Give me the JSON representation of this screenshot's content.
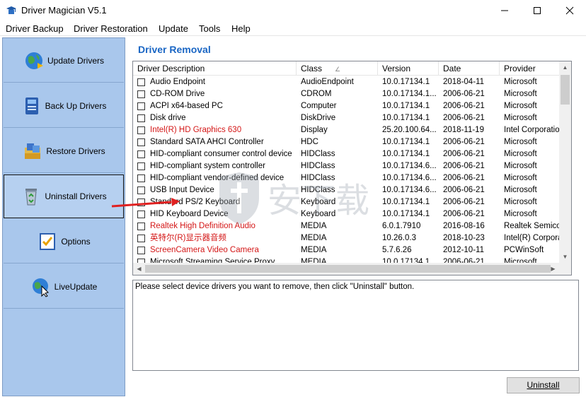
{
  "window": {
    "title": "Driver Magician V5.1",
    "icon": "graduation-cap-icon",
    "controls": [
      "minimize-icon",
      "maximize-icon",
      "close-icon"
    ]
  },
  "menu": [
    "Driver Backup",
    "Driver Restoration",
    "Update",
    "Tools",
    "Help"
  ],
  "sidebar": {
    "items": [
      {
        "label": "Update Drivers",
        "icon": "globe-update-icon"
      },
      {
        "label": "Back Up Drivers",
        "icon": "backup-icon"
      },
      {
        "label": "Restore Drivers",
        "icon": "restore-icon"
      },
      {
        "label": "Uninstall Drivers",
        "icon": "recycle-bin-icon",
        "active": true
      },
      {
        "label": "Options",
        "icon": "checklist-icon"
      },
      {
        "label": "LiveUpdate",
        "icon": "globe-cursor-icon"
      }
    ]
  },
  "main": {
    "title": "Driver Removal",
    "columns": [
      "Driver Description",
      "Class",
      "Version",
      "Date",
      "Provider"
    ],
    "rows": [
      {
        "desc": "Audio Endpoint",
        "class": "AudioEndpoint",
        "version": "10.0.17134.1",
        "date": "2018-04-11",
        "provider": "Microsoft",
        "red": false
      },
      {
        "desc": "CD-ROM Drive",
        "class": "CDROM",
        "version": "10.0.17134.1...",
        "date": "2006-06-21",
        "provider": "Microsoft",
        "red": false
      },
      {
        "desc": "ACPI x64-based PC",
        "class": "Computer",
        "version": "10.0.17134.1",
        "date": "2006-06-21",
        "provider": "Microsoft",
        "red": false
      },
      {
        "desc": "Disk drive",
        "class": "DiskDrive",
        "version": "10.0.17134.1",
        "date": "2006-06-21",
        "provider": "Microsoft",
        "red": false
      },
      {
        "desc": "Intel(R) HD Graphics 630",
        "class": "Display",
        "version": "25.20.100.64...",
        "date": "2018-11-19",
        "provider": "Intel Corporation",
        "red": true
      },
      {
        "desc": "Standard SATA AHCI Controller",
        "class": "HDC",
        "version": "10.0.17134.1",
        "date": "2006-06-21",
        "provider": "Microsoft",
        "red": false
      },
      {
        "desc": "HID-compliant consumer control device",
        "class": "HIDClass",
        "version": "10.0.17134.1",
        "date": "2006-06-21",
        "provider": "Microsoft",
        "red": false
      },
      {
        "desc": "HID-compliant system controller",
        "class": "HIDClass",
        "version": "10.0.17134.6...",
        "date": "2006-06-21",
        "provider": "Microsoft",
        "red": false
      },
      {
        "desc": "HID-compliant vendor-defined device",
        "class": "HIDClass",
        "version": "10.0.17134.6...",
        "date": "2006-06-21",
        "provider": "Microsoft",
        "red": false
      },
      {
        "desc": "USB Input Device",
        "class": "HIDClass",
        "version": "10.0.17134.6...",
        "date": "2006-06-21",
        "provider": "Microsoft",
        "red": false
      },
      {
        "desc": "Standard PS/2 Keyboard",
        "class": "Keyboard",
        "version": "10.0.17134.1",
        "date": "2006-06-21",
        "provider": "Microsoft",
        "red": false
      },
      {
        "desc": "HID Keyboard Device",
        "class": "Keyboard",
        "version": "10.0.17134.1",
        "date": "2006-06-21",
        "provider": "Microsoft",
        "red": false
      },
      {
        "desc": "Realtek High Definition Audio",
        "class": "MEDIA",
        "version": "6.0.1.7910",
        "date": "2016-08-16",
        "provider": "Realtek Semiconductor",
        "red": true
      },
      {
        "desc": "英特尔(R)显示器音频",
        "class": "MEDIA",
        "version": "10.26.0.3",
        "date": "2018-10-23",
        "provider": "Intel(R) Corporation",
        "red": true
      },
      {
        "desc": "ScreenCamera Video Camera",
        "class": "MEDIA",
        "version": "5.7.6.26",
        "date": "2012-10-11",
        "provider": "PCWinSoft",
        "red": true
      },
      {
        "desc": "Microsoft Streaming Service Proxy",
        "class": "MEDIA",
        "version": "10.0.17134.1",
        "date": "2006-06-21",
        "provider": "Microsoft",
        "red": false
      }
    ],
    "info_text": "Please select device drivers you want to remove, then click \"Uninstall\" button.",
    "uninstall_label": "Uninstall"
  },
  "watermark_text": "安下载",
  "colors": {
    "sidebar_bg": "#a9c7ec",
    "title_blue": "#1a66c4",
    "highlight_red": "#d41616",
    "arrow_red": "#e02020"
  }
}
